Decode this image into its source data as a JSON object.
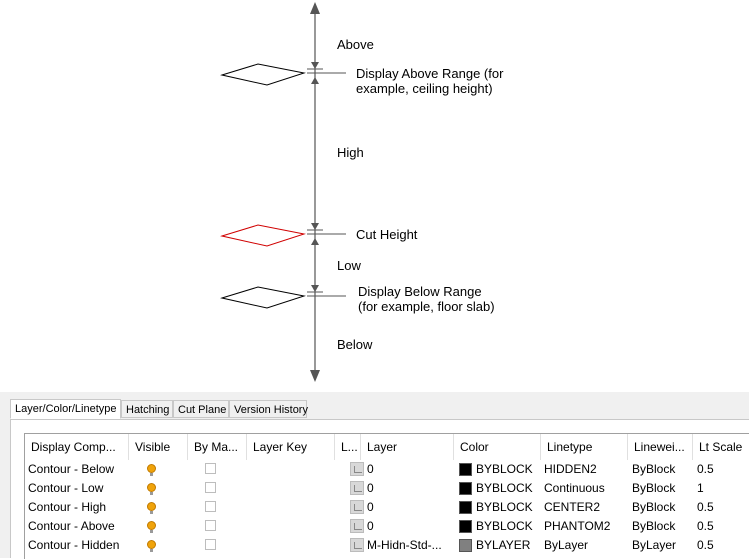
{
  "diagram": {
    "labels": {
      "above": "Above",
      "display_above": "Display Above Range (for\nexample, ceiling height)",
      "high": "High",
      "cut_height": "Cut Height",
      "low": "Low",
      "display_below": "Display Below Range\n(for example, floor slab)",
      "below": "Below"
    },
    "colors": {
      "line": "#555555",
      "plane": "#000000",
      "cut_plane": "#d00000"
    }
  },
  "tabs": [
    {
      "label": "Layer/Color/Linetype",
      "active": true
    },
    {
      "label": "Hatching",
      "active": false
    },
    {
      "label": "Cut Plane",
      "active": false
    },
    {
      "label": "Version History",
      "active": false
    }
  ],
  "table": {
    "columns": [
      "Display Comp...",
      "Visible",
      "By Ma...",
      "Layer Key",
      "L...",
      "Layer",
      "Color",
      "Linetype",
      "Linewei...",
      "Lt Scale"
    ],
    "rows": [
      {
        "component": "Contour - Below",
        "visible": true,
        "by_material": false,
        "layer_key": "",
        "layer": "0",
        "color_name": "BYBLOCK",
        "color_hex": "#000000",
        "linetype": "HIDDEN2",
        "lineweight": "ByBlock",
        "lt_scale": "0.5"
      },
      {
        "component": "Contour - Low",
        "visible": true,
        "by_material": false,
        "layer_key": "",
        "layer": "0",
        "color_name": "BYBLOCK",
        "color_hex": "#000000",
        "linetype": "Continuous",
        "lineweight": "ByBlock",
        "lt_scale": "1"
      },
      {
        "component": "Contour - High",
        "visible": true,
        "by_material": false,
        "layer_key": "",
        "layer": "0",
        "color_name": "BYBLOCK",
        "color_hex": "#000000",
        "linetype": "CENTER2",
        "lineweight": "ByBlock",
        "lt_scale": "0.5"
      },
      {
        "component": "Contour - Above",
        "visible": true,
        "by_material": false,
        "layer_key": "",
        "layer": "0",
        "color_name": "BYBLOCK",
        "color_hex": "#000000",
        "linetype": "PHANTOM2",
        "lineweight": "ByBlock",
        "lt_scale": "0.5"
      },
      {
        "component": "Contour - Hidden",
        "visible": true,
        "by_material": false,
        "layer_key": "",
        "layer": "M-Hidn-Std-...",
        "color_name": "BYLAYER",
        "color_hex": "#808080",
        "linetype": "ByLayer",
        "lineweight": "ByLayer",
        "lt_scale": "0.5"
      }
    ]
  }
}
